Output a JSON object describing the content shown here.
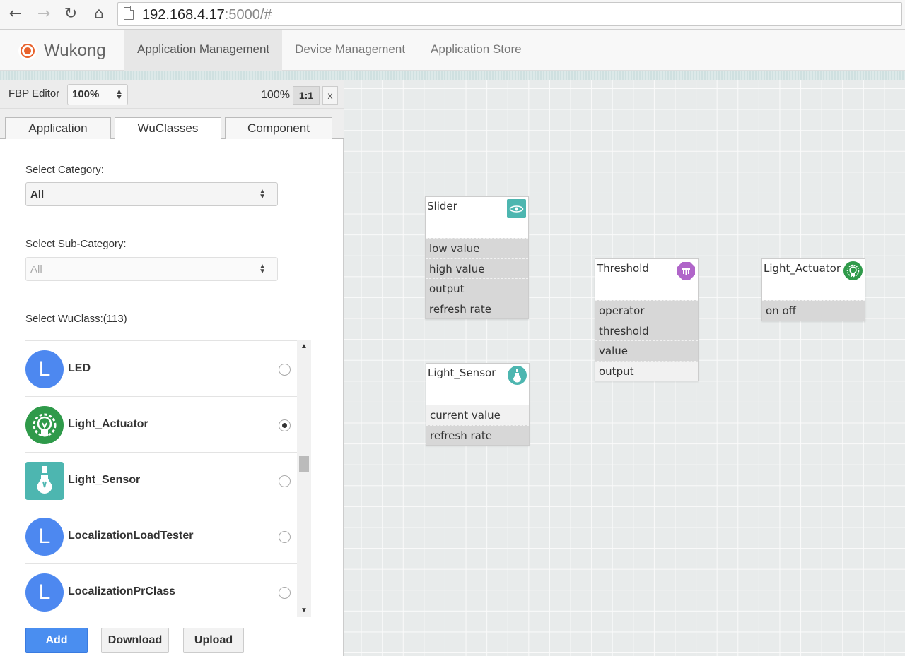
{
  "browser": {
    "url_host": "192.168.4.17",
    "url_rest": ":5000/#"
  },
  "header": {
    "brand": "Wukong",
    "nav": [
      "Application Management",
      "Device Management",
      "Application Store"
    ],
    "active_nav": "Application Management"
  },
  "editor": {
    "label": "FBP Editor",
    "zoom_select": "100%",
    "zoom_value": "100%",
    "ratio_button": "1:1",
    "close_button": "x"
  },
  "tabs": [
    "Application",
    "WuClasses",
    "Component"
  ],
  "active_tab": "WuClasses",
  "filters": {
    "category_label": "Select Category:",
    "category_value": "All",
    "subcategory_label": "Select Sub-Category:",
    "subcategory_value": "All",
    "wuclass_label": "Select WuClass:(113)"
  },
  "wuclasses": [
    {
      "name": "LED",
      "icon": "letter-L-icon",
      "letter": "L",
      "selected": false
    },
    {
      "name": "Light_Actuator",
      "icon": "light-actuator-icon",
      "selected": true
    },
    {
      "name": "Light_Sensor",
      "icon": "light-sensor-icon",
      "selected": false
    },
    {
      "name": "LocalizationLoadTester",
      "icon": "letter-L-icon",
      "letter": "L",
      "selected": false
    },
    {
      "name": "LocalizationPrClass",
      "icon": "letter-L-icon",
      "letter": "L",
      "selected": false
    }
  ],
  "buttons": {
    "add": "Add",
    "download": "Download",
    "upload": "Upload"
  },
  "canvas_nodes": [
    {
      "title": "Slider",
      "icon": "slider-icon",
      "properties": [
        "low value",
        "high value",
        "output",
        "refresh rate"
      ]
    },
    {
      "title": "Light_Sensor",
      "icon": "light-sensor-icon",
      "properties": [
        "current value",
        "refresh rate"
      ]
    },
    {
      "title": "Threshold",
      "icon": "threshold-icon",
      "properties": [
        "operator",
        "threshold",
        "value",
        "output"
      ]
    },
    {
      "title": "Light_Actuator",
      "icon": "light-actuator-icon",
      "properties": [
        "on off"
      ]
    }
  ],
  "colors": {
    "primary_button": "#4a8ef0",
    "letter_icon": "#4d88f0",
    "actuator_green": "#2f9a4a",
    "sensor_teal": "#4db6b0",
    "threshold_purple": "#b065c9",
    "brand_orange": "#e8622c"
  }
}
